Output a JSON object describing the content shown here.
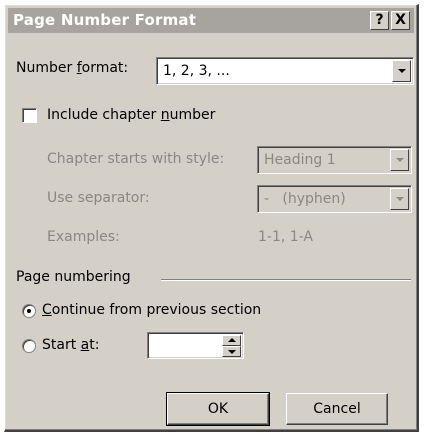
{
  "window": {
    "title": "Page Number Format",
    "help_button": "?",
    "close_button": "X"
  },
  "number_format": {
    "label_pre": "Number ",
    "label_mnemonic": "f",
    "label_post": "ormat:",
    "value": "1, 2, 3, ..."
  },
  "include_chapter": {
    "label_pre": "Include chapter ",
    "label_mnemonic": "n",
    "label_post": "umber",
    "checked": false
  },
  "chapter_style": {
    "label": "Chapter starts with style:",
    "value": "Heading 1"
  },
  "separator": {
    "label": "Use separator:",
    "value": "-   (hyphen)"
  },
  "examples": {
    "label": "Examples:",
    "value": "1-1, 1-A"
  },
  "page_numbering": {
    "group_label": "Page numbering",
    "continue_pre": "",
    "continue_mnemonic": "C",
    "continue_post": "ontinue from previous section",
    "continue_selected": true,
    "start_pre": "Start ",
    "start_mnemonic": "a",
    "start_post": "t:",
    "start_value": ""
  },
  "buttons": {
    "ok": "OK",
    "cancel": "Cancel"
  }
}
